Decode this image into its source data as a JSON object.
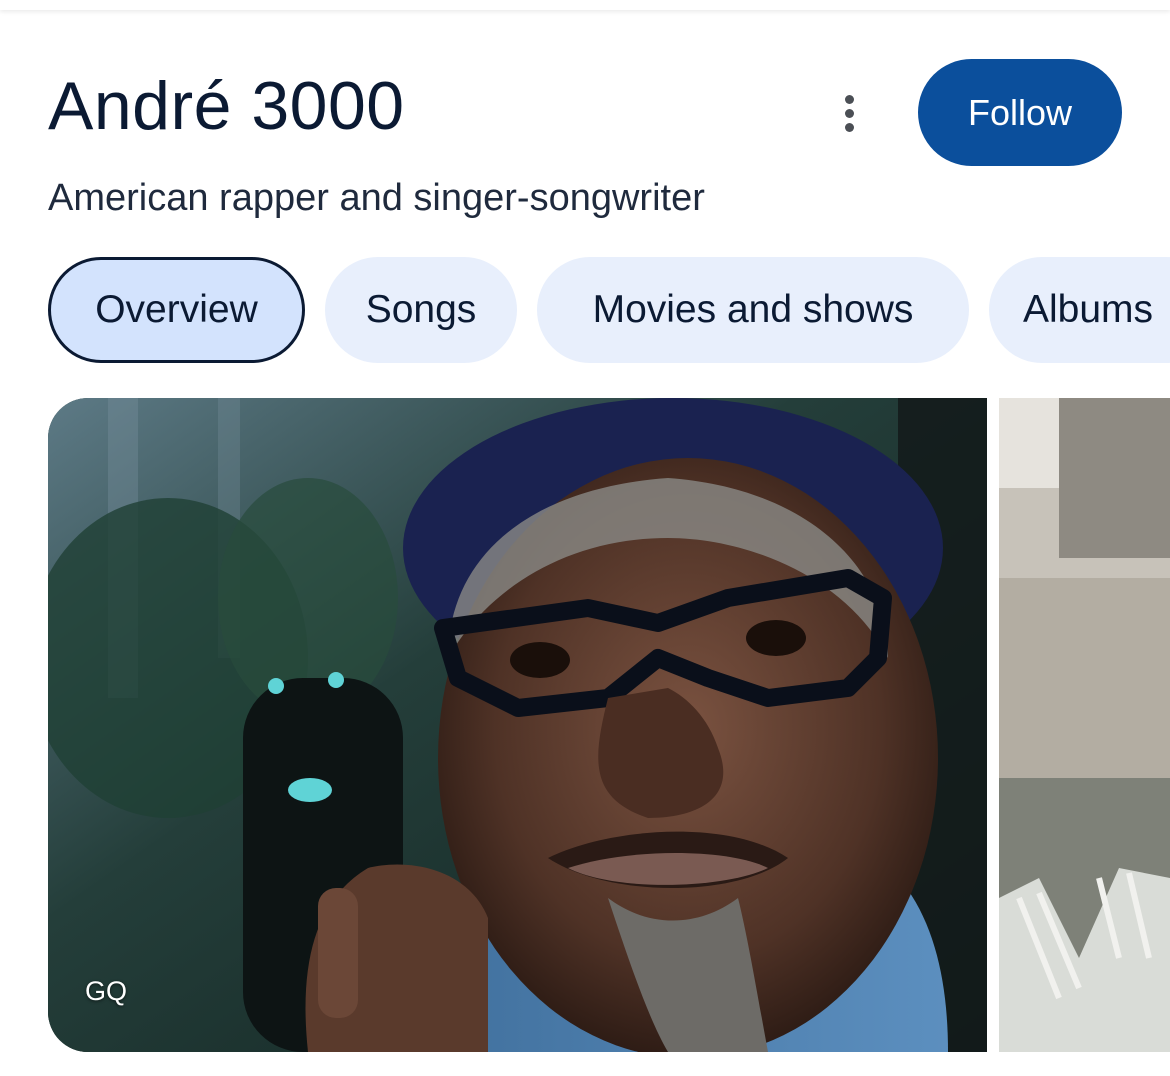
{
  "header": {
    "title": "André 3000",
    "subtitle": "American rapper and singer-songwriter",
    "follow_label": "Follow",
    "more_icon": "more-vert-icon"
  },
  "tabs": [
    {
      "label": "Overview",
      "active": true
    },
    {
      "label": "Songs",
      "active": false
    },
    {
      "label": "Movies and shows",
      "active": false
    },
    {
      "label": "Albums",
      "active": false
    }
  ],
  "images": {
    "main_source": "GQ"
  },
  "colors": {
    "follow_button": "#0b4f9c",
    "tab_bg": "#e8effc",
    "tab_active_bg": "#d3e3fd",
    "title_text": "#0b1a33"
  }
}
